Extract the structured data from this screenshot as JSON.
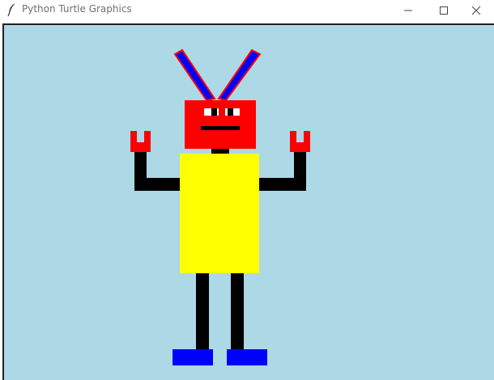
{
  "window": {
    "title": "Python Turtle Graphics",
    "app_icon": "feather-icon",
    "controls": [
      "minimize-icon",
      "maximize-icon",
      "close-icon"
    ]
  },
  "canvas": {
    "background_color": "#add8e6",
    "drawing": "robot",
    "colors": {
      "antenna_fill": "#0000ff",
      "antenna_outline": "#ff0000",
      "head": "#ff0000",
      "eye_white": "#ffffff",
      "features": "#000000",
      "body": "#ffff00",
      "arms": "#000000",
      "hands": "#ff0000",
      "legs": "#000000",
      "feet": "#0000ff"
    }
  }
}
